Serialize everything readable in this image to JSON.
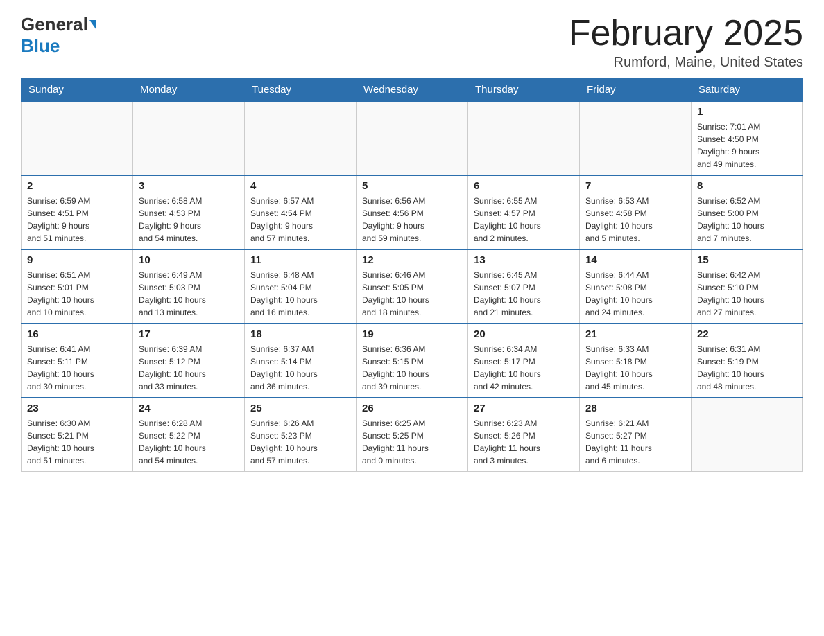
{
  "header": {
    "logo_general": "General",
    "logo_blue": "Blue",
    "month_title": "February 2025",
    "location": "Rumford, Maine, United States"
  },
  "weekdays": [
    "Sunday",
    "Monday",
    "Tuesday",
    "Wednesday",
    "Thursday",
    "Friday",
    "Saturday"
  ],
  "weeks": [
    [
      {
        "day": "",
        "info": ""
      },
      {
        "day": "",
        "info": ""
      },
      {
        "day": "",
        "info": ""
      },
      {
        "day": "",
        "info": ""
      },
      {
        "day": "",
        "info": ""
      },
      {
        "day": "",
        "info": ""
      },
      {
        "day": "1",
        "info": "Sunrise: 7:01 AM\nSunset: 4:50 PM\nDaylight: 9 hours\nand 49 minutes."
      }
    ],
    [
      {
        "day": "2",
        "info": "Sunrise: 6:59 AM\nSunset: 4:51 PM\nDaylight: 9 hours\nand 51 minutes."
      },
      {
        "day": "3",
        "info": "Sunrise: 6:58 AM\nSunset: 4:53 PM\nDaylight: 9 hours\nand 54 minutes."
      },
      {
        "day": "4",
        "info": "Sunrise: 6:57 AM\nSunset: 4:54 PM\nDaylight: 9 hours\nand 57 minutes."
      },
      {
        "day": "5",
        "info": "Sunrise: 6:56 AM\nSunset: 4:56 PM\nDaylight: 9 hours\nand 59 minutes."
      },
      {
        "day": "6",
        "info": "Sunrise: 6:55 AM\nSunset: 4:57 PM\nDaylight: 10 hours\nand 2 minutes."
      },
      {
        "day": "7",
        "info": "Sunrise: 6:53 AM\nSunset: 4:58 PM\nDaylight: 10 hours\nand 5 minutes."
      },
      {
        "day": "8",
        "info": "Sunrise: 6:52 AM\nSunset: 5:00 PM\nDaylight: 10 hours\nand 7 minutes."
      }
    ],
    [
      {
        "day": "9",
        "info": "Sunrise: 6:51 AM\nSunset: 5:01 PM\nDaylight: 10 hours\nand 10 minutes."
      },
      {
        "day": "10",
        "info": "Sunrise: 6:49 AM\nSunset: 5:03 PM\nDaylight: 10 hours\nand 13 minutes."
      },
      {
        "day": "11",
        "info": "Sunrise: 6:48 AM\nSunset: 5:04 PM\nDaylight: 10 hours\nand 16 minutes."
      },
      {
        "day": "12",
        "info": "Sunrise: 6:46 AM\nSunset: 5:05 PM\nDaylight: 10 hours\nand 18 minutes."
      },
      {
        "day": "13",
        "info": "Sunrise: 6:45 AM\nSunset: 5:07 PM\nDaylight: 10 hours\nand 21 minutes."
      },
      {
        "day": "14",
        "info": "Sunrise: 6:44 AM\nSunset: 5:08 PM\nDaylight: 10 hours\nand 24 minutes."
      },
      {
        "day": "15",
        "info": "Sunrise: 6:42 AM\nSunset: 5:10 PM\nDaylight: 10 hours\nand 27 minutes."
      }
    ],
    [
      {
        "day": "16",
        "info": "Sunrise: 6:41 AM\nSunset: 5:11 PM\nDaylight: 10 hours\nand 30 minutes."
      },
      {
        "day": "17",
        "info": "Sunrise: 6:39 AM\nSunset: 5:12 PM\nDaylight: 10 hours\nand 33 minutes."
      },
      {
        "day": "18",
        "info": "Sunrise: 6:37 AM\nSunset: 5:14 PM\nDaylight: 10 hours\nand 36 minutes."
      },
      {
        "day": "19",
        "info": "Sunrise: 6:36 AM\nSunset: 5:15 PM\nDaylight: 10 hours\nand 39 minutes."
      },
      {
        "day": "20",
        "info": "Sunrise: 6:34 AM\nSunset: 5:17 PM\nDaylight: 10 hours\nand 42 minutes."
      },
      {
        "day": "21",
        "info": "Sunrise: 6:33 AM\nSunset: 5:18 PM\nDaylight: 10 hours\nand 45 minutes."
      },
      {
        "day": "22",
        "info": "Sunrise: 6:31 AM\nSunset: 5:19 PM\nDaylight: 10 hours\nand 48 minutes."
      }
    ],
    [
      {
        "day": "23",
        "info": "Sunrise: 6:30 AM\nSunset: 5:21 PM\nDaylight: 10 hours\nand 51 minutes."
      },
      {
        "day": "24",
        "info": "Sunrise: 6:28 AM\nSunset: 5:22 PM\nDaylight: 10 hours\nand 54 minutes."
      },
      {
        "day": "25",
        "info": "Sunrise: 6:26 AM\nSunset: 5:23 PM\nDaylight: 10 hours\nand 57 minutes."
      },
      {
        "day": "26",
        "info": "Sunrise: 6:25 AM\nSunset: 5:25 PM\nDaylight: 11 hours\nand 0 minutes."
      },
      {
        "day": "27",
        "info": "Sunrise: 6:23 AM\nSunset: 5:26 PM\nDaylight: 11 hours\nand 3 minutes."
      },
      {
        "day": "28",
        "info": "Sunrise: 6:21 AM\nSunset: 5:27 PM\nDaylight: 11 hours\nand 6 minutes."
      },
      {
        "day": "",
        "info": ""
      }
    ]
  ]
}
